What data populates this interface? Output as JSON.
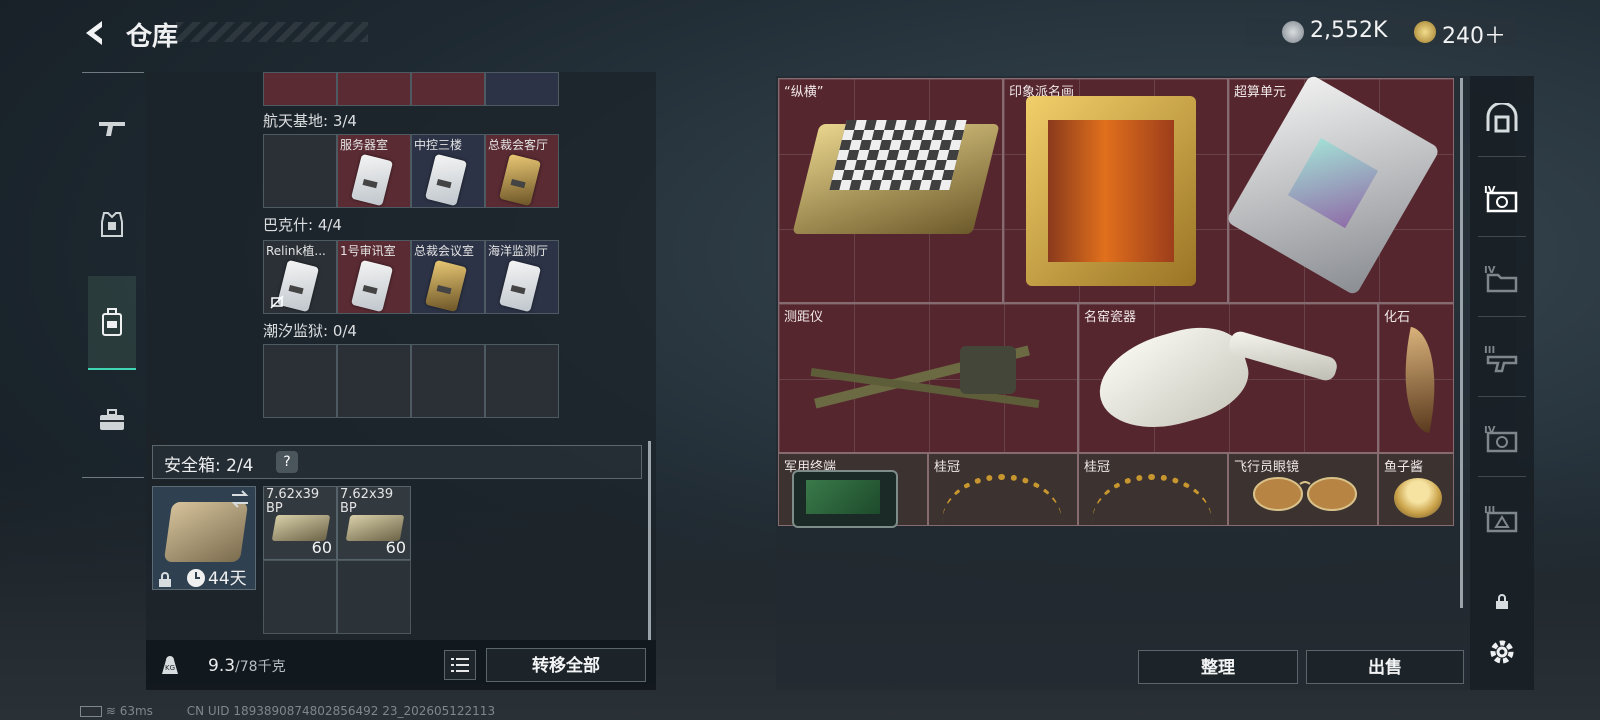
{
  "header": {
    "title": "仓库",
    "currency_silver": "2,552K",
    "currency_gold": "240＋",
    "version_tag": "..."
  },
  "left_nav": {
    "items": [
      {
        "icon": "gun-icon"
      },
      {
        "icon": "armor-icon"
      },
      {
        "icon": "backpack-icon"
      },
      {
        "icon": "toolbox-icon"
      }
    ],
    "active_index": 2
  },
  "keycard_sections": [
    {
      "label": "航天基地: 3/4",
      "cards": [
        {
          "label": "",
          "bg": "dark"
        },
        {
          "label": "服务器室",
          "bg": "red",
          "card": "silver"
        },
        {
          "label": "中控三楼",
          "bg": "navy",
          "card": "silver"
        },
        {
          "label": "总裁会客厅",
          "bg": "red",
          "card": "gold"
        }
      ]
    },
    {
      "label": "巴克什: 4/4",
      "cards": [
        {
          "label": "Relink植...",
          "bg": "dark",
          "card": "silver",
          "broken": true
        },
        {
          "label": "1号审讯室",
          "bg": "red",
          "card": "silver"
        },
        {
          "label": "总裁会议室",
          "bg": "navy",
          "card": "gold"
        },
        {
          "label": "海洋监测厅",
          "bg": "navy",
          "card": "silver"
        }
      ]
    },
    {
      "label": "潮汐监狱: 0/4",
      "cards": [
        {
          "label": "",
          "bg": "dark"
        },
        {
          "label": "",
          "bg": "dark"
        },
        {
          "label": "",
          "bg": "dark"
        },
        {
          "label": "",
          "bg": "dark"
        }
      ]
    }
  ],
  "safe_box": {
    "label": "安全箱: 2/4",
    "help": "?",
    "time_left": "44天",
    "ammo": [
      {
        "label": "7.62x39 BP",
        "count": "60"
      },
      {
        "label": "7.62x39 BP",
        "count": "60"
      }
    ]
  },
  "weight": {
    "current": "9.3",
    "capacity": "/78千克"
  },
  "buttons": {
    "transfer_all": "转移全部",
    "organize": "整理",
    "sell": "出售"
  },
  "stash_items": [
    {
      "name": "“纵横”"
    },
    {
      "name": "印象派名画"
    },
    {
      "name": "超算单元"
    },
    {
      "name": "测距仪"
    },
    {
      "name": "名窑瓷器"
    },
    {
      "name": "化石"
    },
    {
      "name": "军用终端"
    },
    {
      "name": "桂冠"
    },
    {
      "name": "桂冠"
    },
    {
      "name": "飞行员眼镜"
    },
    {
      "name": "鱼子酱"
    }
  ],
  "right_rail": [
    {
      "icon": "vault-icon",
      "level": ""
    },
    {
      "icon": "module-iv-icon",
      "level": "IV"
    },
    {
      "icon": "folder-iv-icon",
      "level": "IV"
    },
    {
      "icon": "weapon-iii-icon",
      "level": "III"
    },
    {
      "icon": "gear-iv-icon",
      "level": "IV"
    },
    {
      "icon": "shield-iii-icon",
      "level": "III"
    },
    {
      "icon": "lock-icon",
      "level": ""
    },
    {
      "icon": "settings-icon",
      "level": ""
    }
  ],
  "footer": {
    "ping": "63ms",
    "uid": "CN UID 1893890874802856492 23_202605122113"
  }
}
